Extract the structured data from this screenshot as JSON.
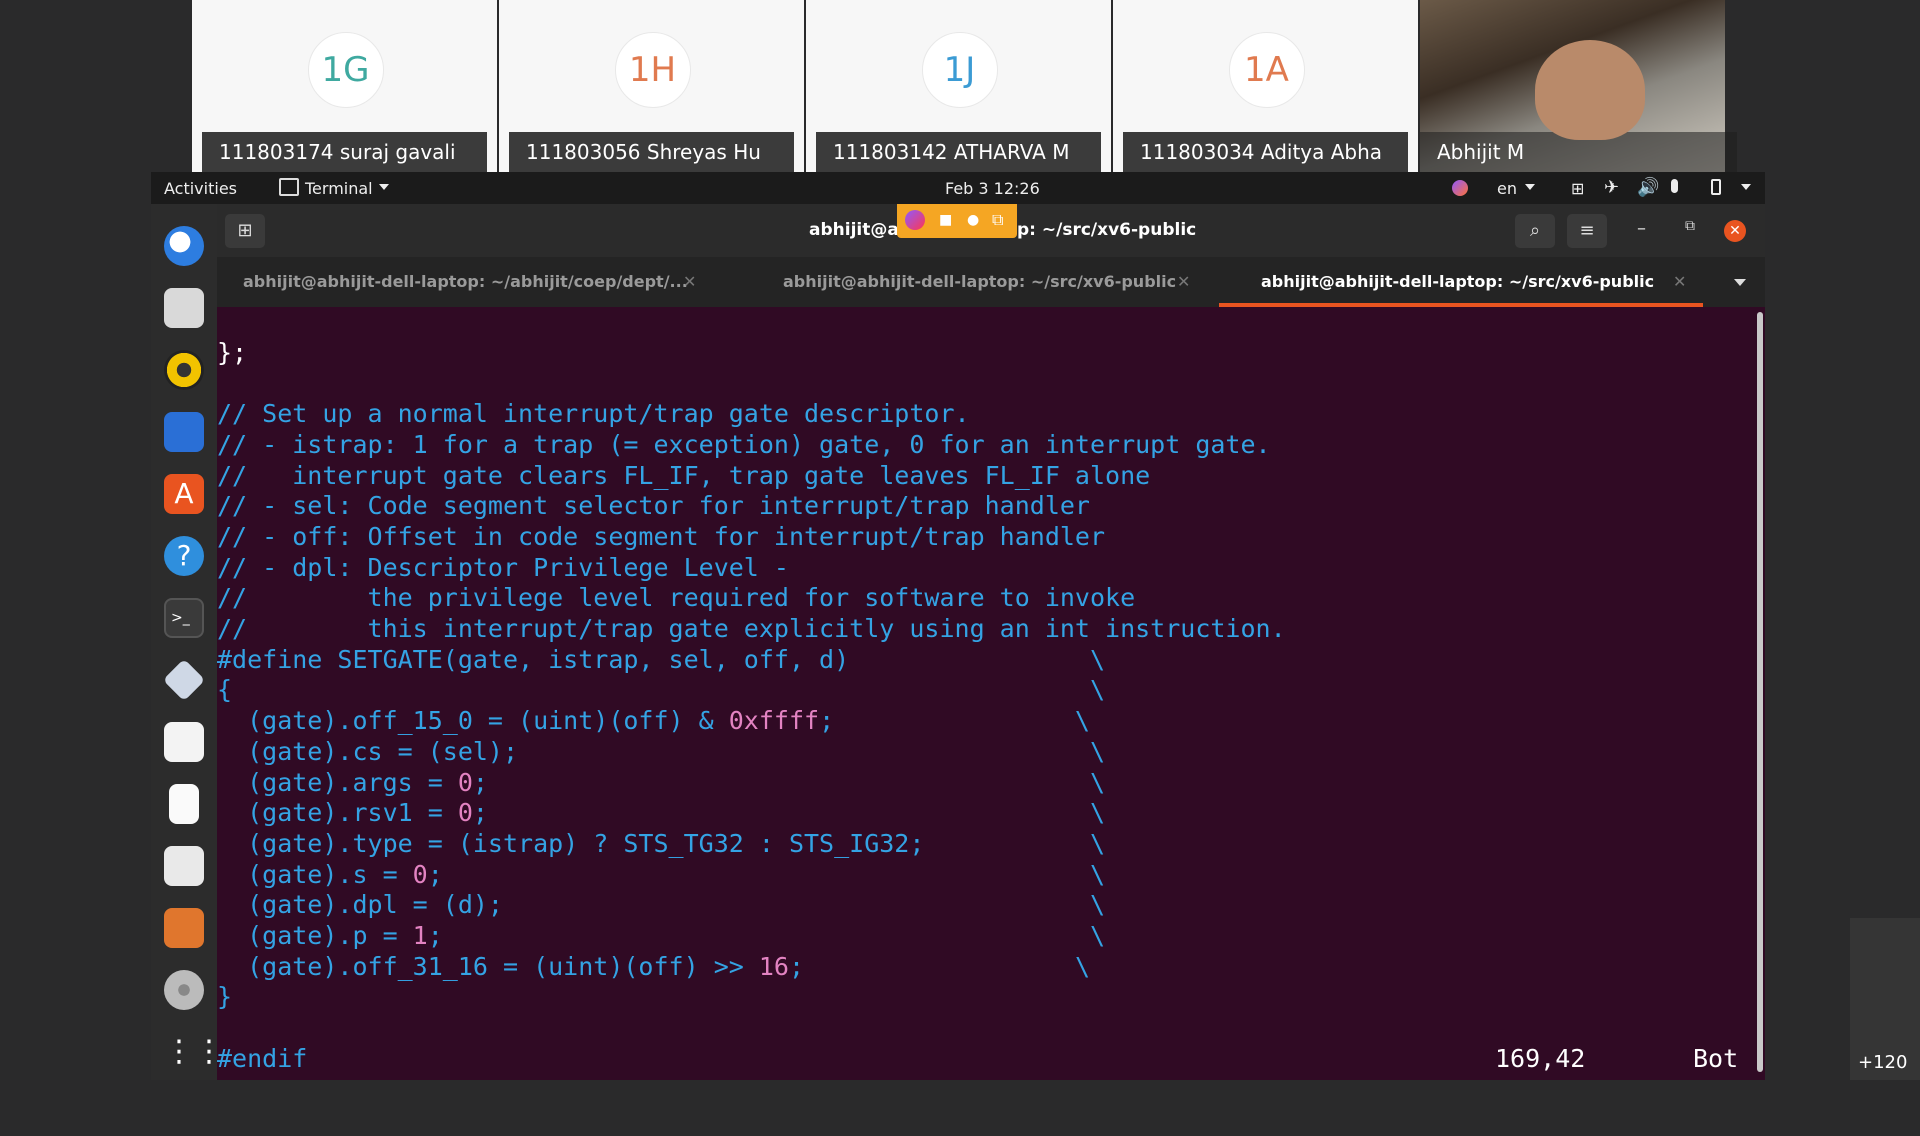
{
  "participants": [
    {
      "initials": "1G",
      "initials_color": "#3fa9a0",
      "name": "111803174 suraj gavali"
    },
    {
      "initials": "1H",
      "initials_color": "#e07a4f",
      "name": "111803056 Shreyas Hu"
    },
    {
      "initials": "1J",
      "initials_color": "#3b9bd4",
      "name": "111803142 ATHARVA M"
    },
    {
      "initials": "1A",
      "initials_color": "#e07a4f",
      "name": "111803034 Aditya Abha"
    },
    {
      "initials": "",
      "initials_color": "",
      "name": "Abhijit M"
    }
  ],
  "topbar": {
    "activities": "Activities",
    "app": "Terminal",
    "datetime": "Feb 3  12:26",
    "lang": "en"
  },
  "window": {
    "title_left": "abhijit@ab",
    "title_right": "p: ~/src/xv6-public",
    "tabs": [
      {
        "label": "abhijit@abhijit-dell-laptop: ~/abhijit/coep/dept/...",
        "active": false
      },
      {
        "label": "abhijit@abhijit-dell-laptop: ~/src/xv6-public",
        "active": false
      },
      {
        "label": "abhijit@abhijit-dell-laptop: ~/src/xv6-public",
        "active": true
      }
    ]
  },
  "code_lines": [
    "};",
    "",
    "// Set up a normal interrupt/trap gate descriptor.",
    "// - istrap: 1 for a trap (= exception) gate, 0 for an interrupt gate.",
    "//   interrupt gate clears FL_IF, trap gate leaves FL_IF alone",
    "// - sel: Code segment selector for interrupt/trap handler",
    "// - off: Offset in code segment for interrupt/trap handler",
    "// - dpl: Descriptor Privilege Level -",
    "//        the privilege level required for software to invoke",
    "//        this interrupt/trap gate explicitly using an int instruction.",
    "#define SETGATE(gate, istrap, sel, off, d)                \\",
    "{                                                         \\",
    "  (gate).off_15_0 = (uint)(off) & 0xffff;                \\",
    "  (gate).cs = (sel);                                      \\",
    "  (gate).args = 0;                                        \\",
    "  (gate).rsv1 = 0;                                        \\",
    "  (gate).type = (istrap) ? STS_TG32 : STS_IG32;           \\",
    "  (gate).s = 0;                                           \\",
    "  (gate).dpl = (d);                                       \\",
    "  (gate).p = 1;                                           \\",
    "  (gate).off_31_16 = (uint)(off) >> 16;                  \\",
    "}",
    "",
    "#endif"
  ],
  "status": {
    "position": "169,42",
    "scroll": "Bot"
  },
  "overflow_count": "+120"
}
